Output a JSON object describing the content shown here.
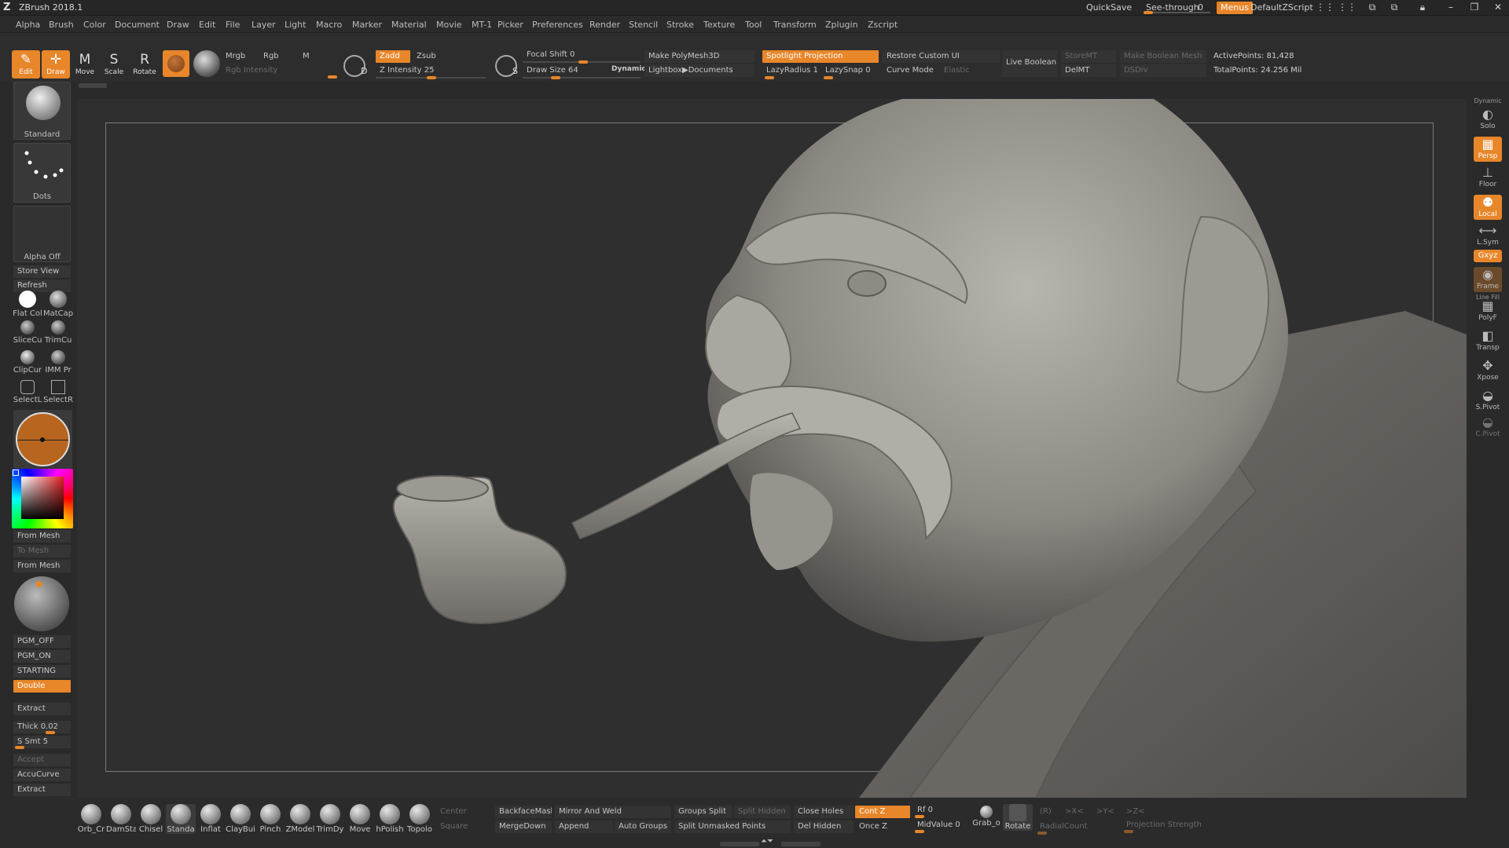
{
  "titlebar": {
    "app_title": "ZBrush 2018.1",
    "quicksave": "QuickSave",
    "see_through_label": "See-through",
    "see_through_value": "0",
    "menus": "Menus",
    "default_zscript": "DefaultZScript"
  },
  "menubar": [
    "Alpha",
    "Brush",
    "Color",
    "Document",
    "Draw",
    "Edit",
    "File",
    "Layer",
    "Light",
    "Macro",
    "Marker",
    "Material",
    "Movie",
    "MT-1",
    "Picker",
    "Preferences",
    "Render",
    "Stencil",
    "Stroke",
    "Texture",
    "Tool",
    "Transform",
    "Zplugin",
    "Zscript"
  ],
  "toolbar": {
    "edit": "Edit",
    "draw": "Draw",
    "move": "Move",
    "scale": "Scale",
    "rotate": "Rotate",
    "mrgb": "Mrgb",
    "rgb": "Rgb",
    "m": "M",
    "rgb_intensity": "Rgb Intensity",
    "zadd": "Zadd",
    "zsub": "Zsub",
    "z_intensity": "Z Intensity 25",
    "focal_shift": "Focal Shift 0",
    "draw_size": "Draw Size 64",
    "dynamic": "Dynamic",
    "make_polymesh": "Make PolyMesh3D",
    "lightbox": "Lightbox▶Documents",
    "spotlight": "Spotlight Projection",
    "restore_custom_ui": "Restore Custom UI",
    "lazy_radius": "LazyRadius 1",
    "lazy_snap": "LazySnap 0",
    "curve_mode": "Curve Mode",
    "elastic": "Elastic",
    "live_boolean": "Live Boolean",
    "store_mt": "StoreMT",
    "del_mt": "DelMT",
    "make_boolean_mesh": "Make Boolean Mesh",
    "dsdiv": "DSDiv",
    "active_points": "ActivePoints: 81,428",
    "total_points": "TotalPoints: 24.256 Mil"
  },
  "left_panel": {
    "brush_label": "Standard",
    "stroke_label": "Dots",
    "alpha_label": "Alpha Off",
    "store_view": "Store View",
    "refresh": "Refresh",
    "flat_color": "Flat Col",
    "matcap": "MatCap",
    "slice_curve": "SliceCu",
    "trim_curve": "TrimCu",
    "clip_curve": "ClipCur",
    "imm_primitives": "IMM Pr",
    "select_lasso": "SelectL",
    "select_rect": "SelectR",
    "from_mesh": "From Mesh",
    "to_mesh": "To Mesh",
    "from_mesh_2": "From Mesh",
    "pgm_off": "PGM_OFF",
    "pgm_on": "PGM_ON",
    "starting": "STARTING",
    "double": "Double",
    "extract": "Extract",
    "thick": "Thick 0.02",
    "s_smt": "S Smt 5",
    "accept": "Accept",
    "accu_curve": "AccuCurve",
    "extract_2": "Extract"
  },
  "right_shelf": {
    "dynamic_label": "Dynamic",
    "solo": "Solo",
    "persp": "Persp",
    "floor": "Floor",
    "local": "Local",
    "lsym": "L.Sym",
    "xyz": "Gxyz",
    "frame": "Frame",
    "line_fill": "Line Fill",
    "polyf": "PolyF",
    "transp": "Transp",
    "xpose": "Xpose",
    "spivot": "S.Pivot",
    "cpivot": "C.Pivot"
  },
  "bottom_shelf": {
    "brushes": [
      "Orb_Cr",
      "DamSta",
      "Chisel",
      "Standa",
      "Inflat",
      "ClayBui",
      "Pinch",
      "ZModel",
      "TrimDy",
      "Move",
      "hPolish",
      "Topolo"
    ],
    "center": "Center",
    "square": "Square",
    "backface_mask": "BackfaceMask",
    "merge_down": "MergeDown",
    "mirror_and_weld": "Mirror And Weld",
    "append": "Append",
    "auto_groups": "Auto Groups",
    "groups_split": "Groups Split",
    "split_hidden": "Split Hidden",
    "split_unmasked": "Split Unmasked Points",
    "close_holes": "Close Holes",
    "del_hidden": "Del Hidden",
    "cont_z": "Cont Z",
    "once_z": "Once Z",
    "rf": "Rf 0",
    "mid_value": "MidValue 0",
    "grab_doc": "Grab_o",
    "rotate": "Rotate",
    "r_label": "(R)",
    "x_sym": ">X<",
    "y_sym": ">Y<",
    "z_sym": ">Z<",
    "radial_count": "RadialCount",
    "projection_strength": "Projection Strength"
  },
  "colors": {
    "accent": "#e8862a",
    "bg": "#2a2a2a",
    "canvas": "#2f2f2f"
  }
}
